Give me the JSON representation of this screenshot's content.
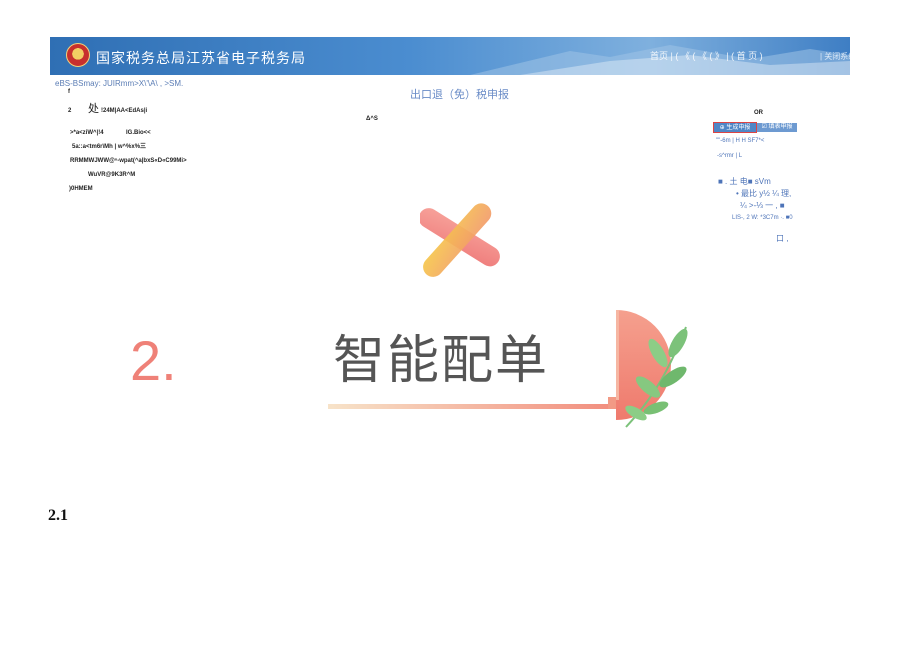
{
  "banner": {
    "title": "国家税务总局江苏省电子税务局",
    "right_text": "首页   |  ( 《 ( 《 ( 》  |  ( 首 页 )",
    "link_text": "| 关闭系统"
  },
  "breadcrumb": "eBS-BSmay: JUIRmm>X\\'\\A\\ , >SM.",
  "page_title": "出口退（免）税申报",
  "left_block": {
    "line1": "f",
    "line2_num": "2",
    "line2_char": "处",
    "line2_text": "!24M|AA<EdAs|i",
    "line3": "Δ^S",
    "line4a": ">*a<ziW^|!4",
    "line4b": "IG.Bio<<",
    "line5": "5a::a<tm6r\\Mh | w^%x%三",
    "line6": "RRMMWJWW@ⁿ-wpat(^a|bxS«D«C99Mi>",
    "line7": "WuVR@9K3R^M",
    "line8": ")0HMEM"
  },
  "right_panel": {
    "header": "OR",
    "button_primary": "⊕ 生成申报",
    "button_secondary": "☑ 填表申报",
    "line1": "\"\"-6m | H H SF7*<",
    "line2": "-s^rmr | L",
    "line3": "■ . 土 电■ sVm",
    "line4": "• 最比 y½ ¼ 理,",
    "line5": "¼ >-⅓ 一 , ■",
    "line6": "LIS-, 2 W: *3C7m ·. ■0",
    "line7": "口 ,"
  },
  "section": {
    "number": "2.",
    "title": "智能配单"
  },
  "sub_heading": "2.1",
  "colors": {
    "accent": "#ef8178",
    "banner": "#3b7cc4",
    "link": "#4e74b8",
    "leaf": "#7cc27a"
  }
}
